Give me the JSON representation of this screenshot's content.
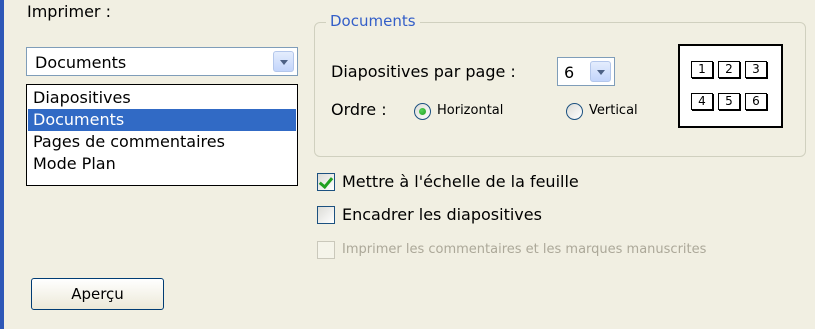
{
  "left_panel": {
    "print_label": "Imprimer :",
    "print_select": {
      "value": "Documents",
      "options": [
        "Diapositives",
        "Documents",
        "Pages de commentaires",
        "Mode Plan"
      ],
      "selected_index": 1
    },
    "preview_button": "Aperçu"
  },
  "documents_group": {
    "title": "Documents",
    "slides_per_page_label": "Diapositives par page :",
    "slides_per_page_value": "6",
    "order_label": "Ordre :",
    "order_options": [
      {
        "label": "Horizontal",
        "checked": true
      },
      {
        "label": "Vertical",
        "checked": false
      }
    ],
    "layout_preview_numbers": [
      "1",
      "2",
      "3",
      "4",
      "5",
      "6"
    ]
  },
  "options": [
    {
      "label": "Mettre à l'échelle de la feuille",
      "checked": true,
      "enabled": true
    },
    {
      "label": "Encadrer les diapositives",
      "checked": false,
      "enabled": true
    },
    {
      "label": "Imprimer les commentaires et les marques manuscrites",
      "checked": false,
      "enabled": false
    }
  ],
  "colors": {
    "window_bg": "#f1efe2",
    "selection": "#316ac5",
    "group_title": "#335ec8",
    "accent_edge": "#2e57b7",
    "check_green": "#21a121"
  }
}
